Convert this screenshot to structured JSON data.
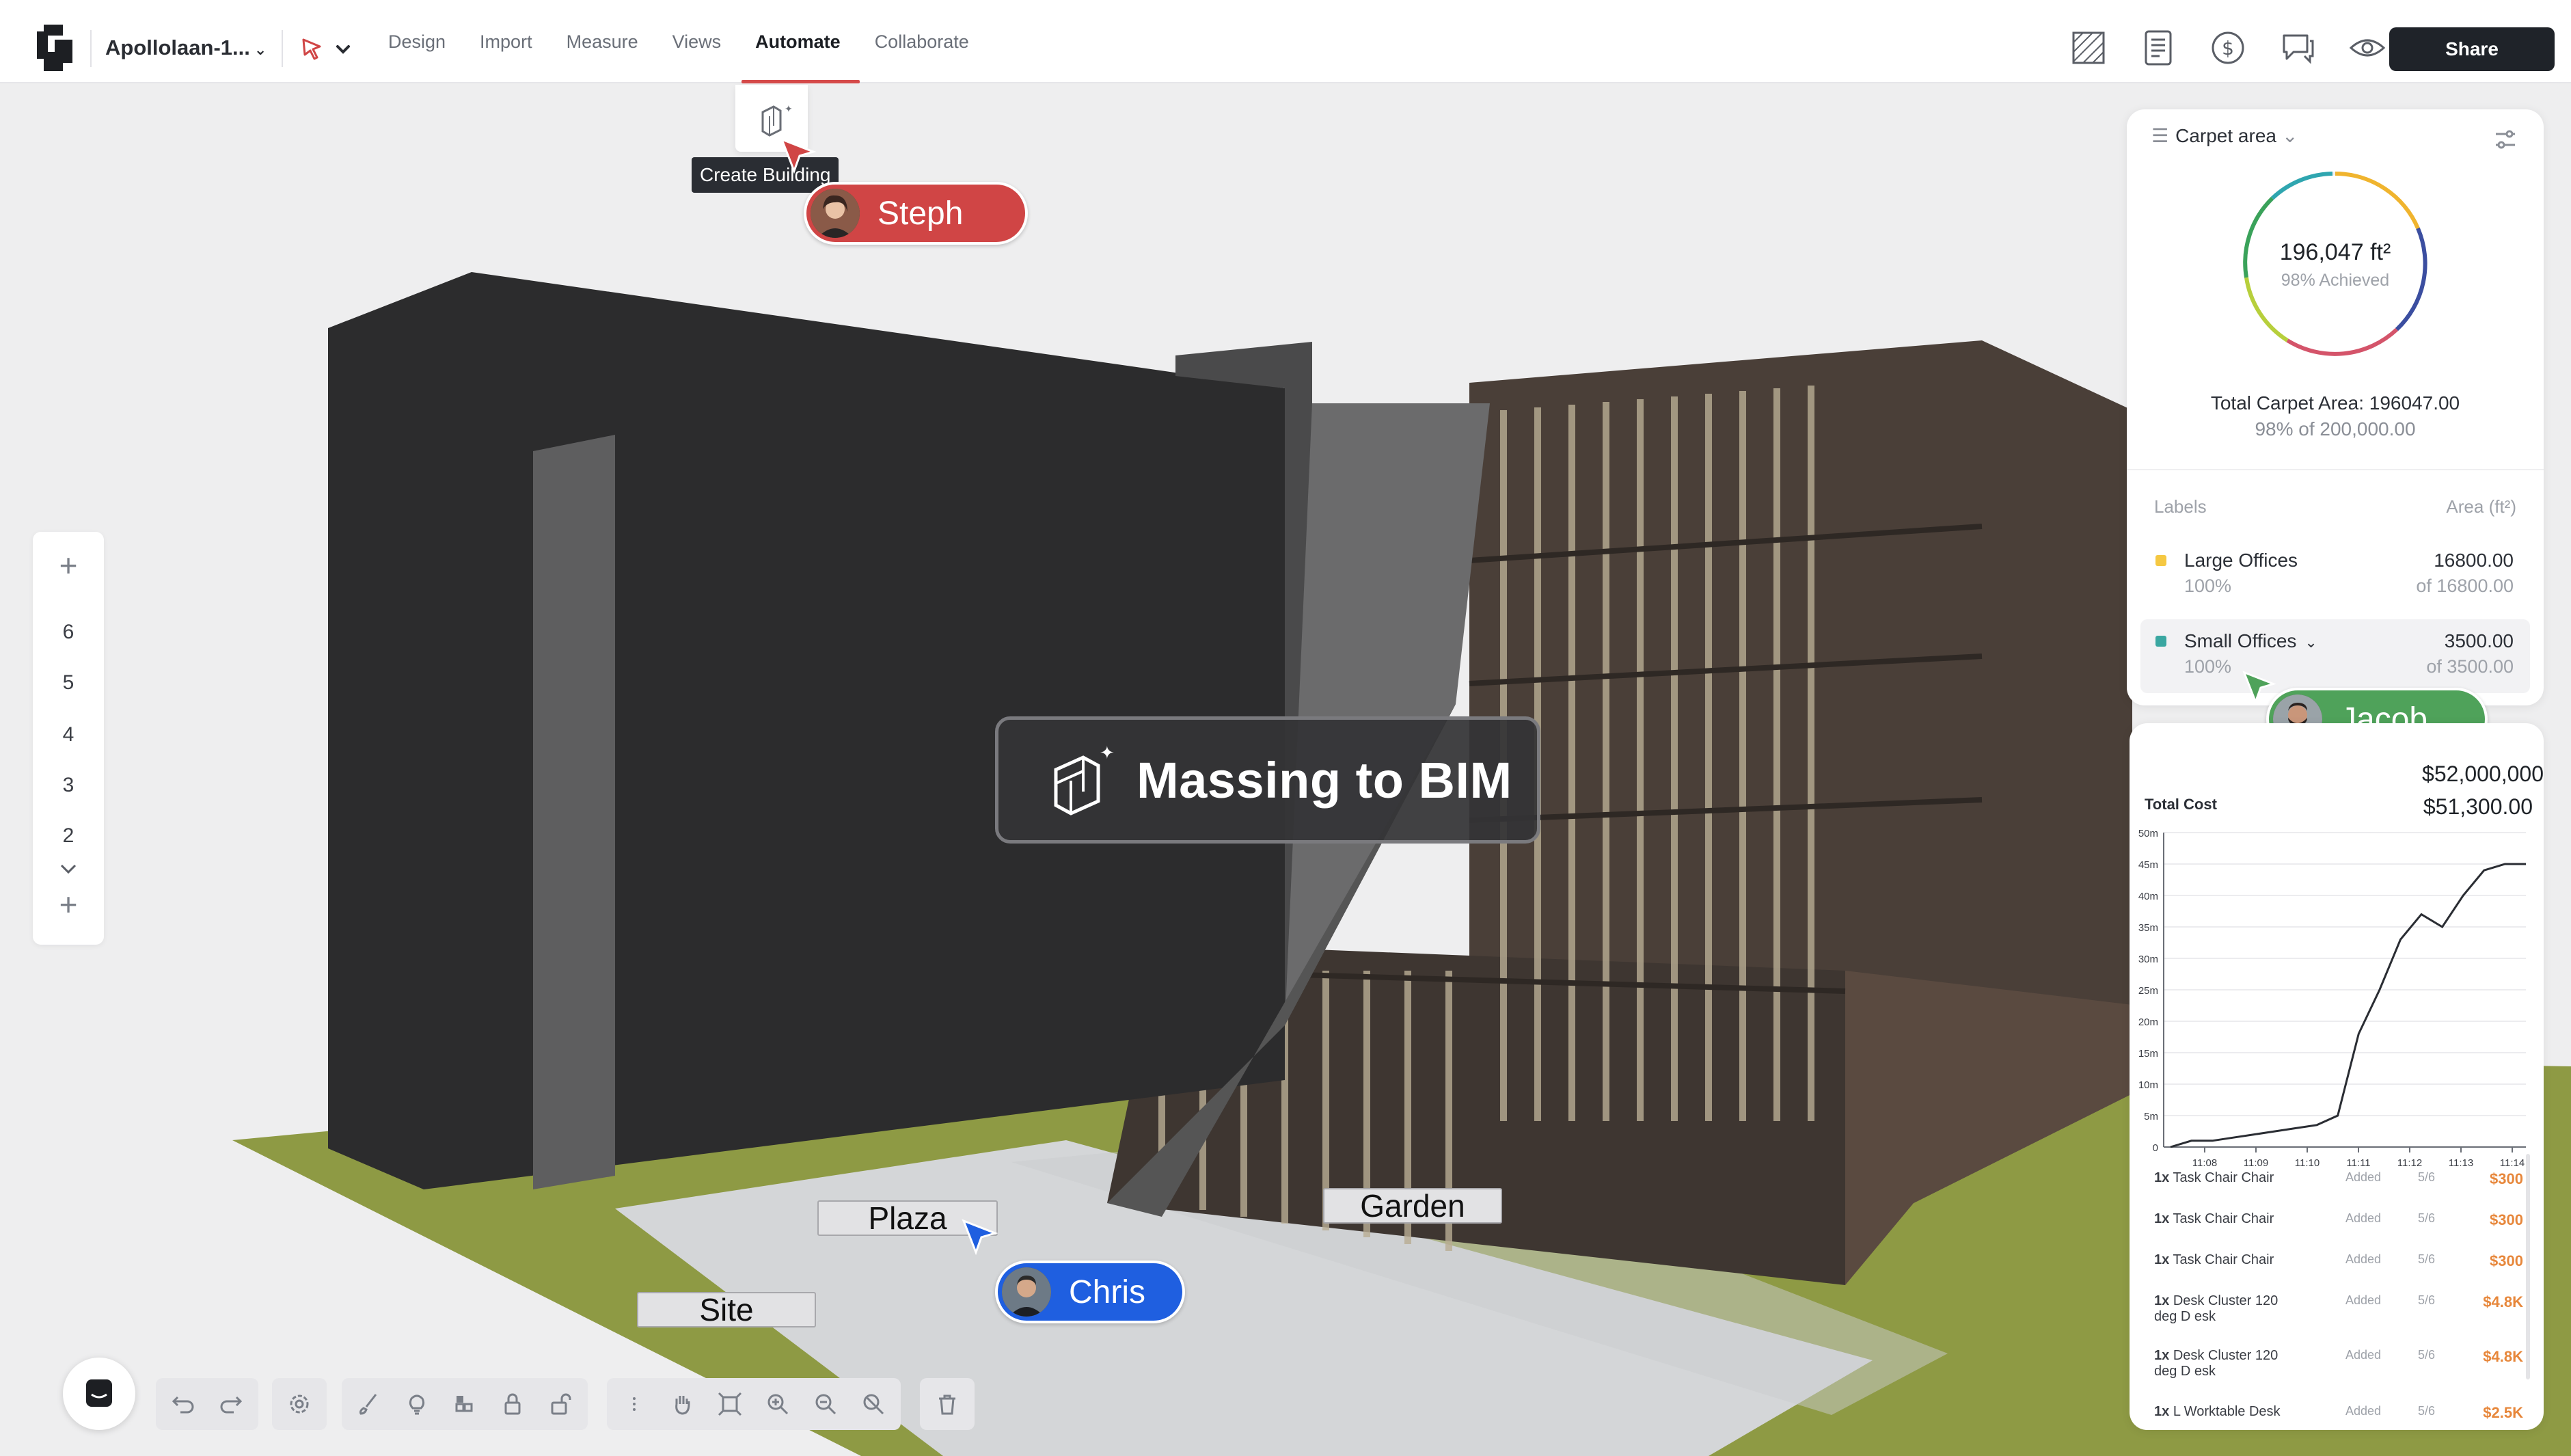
{
  "app": {
    "project_name": "Apollolaan-1...",
    "menu": [
      "Design",
      "Import",
      "Measure",
      "Views",
      "Automate",
      "Collaborate"
    ],
    "active_menu": "Automate",
    "share_label": "Share",
    "right_icons": [
      "floorplan-icon",
      "report-icon",
      "dollar-icon",
      "comments-icon",
      "eye-icon"
    ]
  },
  "automate_popup": {
    "icon": "building-sparkle-icon",
    "tooltip": "Create Building"
  },
  "floors": {
    "levels": [
      "6",
      "5",
      "4",
      "3",
      "2"
    ]
  },
  "center_badge": {
    "icon": "building-sparkle-icon",
    "label": "Massing to BIM"
  },
  "area_labels": {
    "plaza": "Plaza",
    "garden": "Garden",
    "site": "Site"
  },
  "collaborators": [
    {
      "name": "Steph",
      "color": "#d04545"
    },
    {
      "name": "Jacob",
      "color": "#4fa25a"
    },
    {
      "name": "Chris",
      "color": "#1f5fe0"
    }
  ],
  "carpet_area": {
    "title": "Carpet area",
    "value": "196,047 ft²",
    "achieved": "98% Achieved",
    "achieved_fraction": 0.98,
    "total_line": "Total Carpet Area: 196047.00",
    "total_sub": "98% of 200,000.00",
    "col_labels": "Labels",
    "col_area": "Area (ft²)",
    "rows": [
      {
        "label": "Large Offices",
        "pct": "100%",
        "value": "16800.00",
        "of": "of 16800.00",
        "color": "#f5c842"
      },
      {
        "label": "Small Offices",
        "pct": "100%",
        "value": "3500.00",
        "of": "of 3500.00",
        "color": "#3aa7a1"
      }
    ]
  },
  "cost": {
    "budget": "$52,000,000",
    "total": "$51,300.00",
    "total_label": "Total Cost",
    "items": [
      {
        "qty": "1x",
        "name": "Task Chair Chair",
        "status": "Added",
        "date": "5/6",
        "price": "$300"
      },
      {
        "qty": "1x",
        "name": "Task Chair Chair",
        "status": "Added",
        "date": "5/6",
        "price": "$300"
      },
      {
        "qty": "1x",
        "name": "Task Chair Chair",
        "status": "Added",
        "date": "5/6",
        "price": "$300"
      },
      {
        "qty": "1x",
        "name": "Desk Cluster 120 deg D esk",
        "status": "Added",
        "date": "5/6",
        "price": "$4.8K"
      },
      {
        "qty": "1x",
        "name": "Desk Cluster 120 deg D esk",
        "status": "Added",
        "date": "5/6",
        "price": "$4.8K"
      },
      {
        "qty": "1x",
        "name": "L Worktable Desk",
        "status": "Added",
        "date": "5/6",
        "price": "$2.5K"
      }
    ]
  },
  "chart_data": {
    "type": "line",
    "title": "",
    "xlabel": "",
    "ylabel": "",
    "x": [
      "11:07",
      "11:07:30",
      "11:08",
      "11:08:30",
      "11:09",
      "11:09:30",
      "11:10",
      "11:10:15",
      "11:10:30",
      "11:11",
      "11:11:30",
      "11:12",
      "11:12:15",
      "11:12:30",
      "11:13",
      "11:13:20",
      "11:13:40",
      "11:14"
    ],
    "x_ticks": [
      "11:08",
      "11:09",
      "11:10",
      "11:11",
      "11:12",
      "11:13",
      "11:14"
    ],
    "y_ticks": [
      "0",
      "5m",
      "10m",
      "15m",
      "20m",
      "25m",
      "30m",
      "35m",
      "40m",
      "45m",
      "50m"
    ],
    "series": [
      {
        "values": [
          0,
          1,
          1,
          1.5,
          2,
          2.5,
          3,
          3.5,
          5,
          18,
          25,
          33,
          37,
          35,
          40,
          44,
          45,
          45
        ]
      }
    ],
    "ylim": [
      0,
      50
    ],
    "grid": true
  },
  "toolbar": {
    "groups": [
      [
        "undo-icon",
        "redo-icon"
      ],
      [
        "settings-icon"
      ],
      [
        "brush-icon",
        "bulb-icon",
        "blocks-icon",
        "lock-icon",
        "unlock-icon"
      ],
      [
        "more-icon",
        "hand-icon",
        "fit-icon",
        "zoom-in-icon",
        "zoom-out-icon",
        "zoom-reset-icon"
      ],
      [
        "trash-icon"
      ]
    ]
  }
}
